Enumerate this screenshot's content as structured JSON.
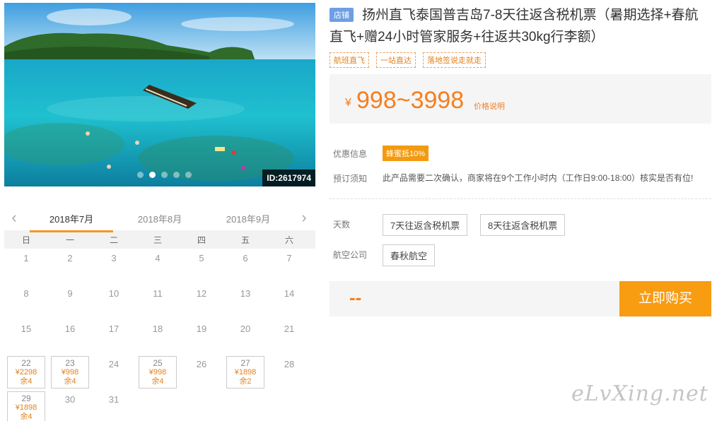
{
  "hero": {
    "id_label": "ID:2617974",
    "slide_count": 5,
    "active_slide": 1
  },
  "calendar": {
    "months": [
      "2018年7月",
      "2018年8月",
      "2018年9月"
    ],
    "active_month": 0,
    "weekdays": [
      "日",
      "一",
      "二",
      "三",
      "四",
      "五",
      "六"
    ],
    "first_weekday": 0,
    "days": [
      {
        "d": "1"
      },
      {
        "d": "2"
      },
      {
        "d": "3"
      },
      {
        "d": "4"
      },
      {
        "d": "5"
      },
      {
        "d": "6"
      },
      {
        "d": "7"
      },
      {
        "d": "8"
      },
      {
        "d": "9"
      },
      {
        "d": "10"
      },
      {
        "d": "11"
      },
      {
        "d": "12"
      },
      {
        "d": "13"
      },
      {
        "d": "14"
      },
      {
        "d": "15"
      },
      {
        "d": "16"
      },
      {
        "d": "17"
      },
      {
        "d": "18"
      },
      {
        "d": "19"
      },
      {
        "d": "20"
      },
      {
        "d": "21"
      },
      {
        "d": "22",
        "price": "¥2298",
        "stock": "余4"
      },
      {
        "d": "23",
        "price": "¥998",
        "stock": "余4"
      },
      {
        "d": "24"
      },
      {
        "d": "25",
        "price": "¥998",
        "stock": "余4"
      },
      {
        "d": "26"
      },
      {
        "d": "27",
        "price": "¥1898",
        "stock": "余2"
      },
      {
        "d": "28"
      },
      {
        "d": "29",
        "price": "¥1898",
        "stock": "余4"
      },
      {
        "d": "30"
      },
      {
        "d": "31"
      }
    ]
  },
  "product": {
    "shop_badge": "店铺",
    "title": "扬州直飞泰国普吉岛7-8天往返含税机票（暑期选择+春航直飞+赠24小时管家服务+往返共30kg行李额）",
    "tags": [
      "航班直飞",
      "一站直达",
      "落地签说走就走"
    ],
    "currency": "¥",
    "price_range": "998~3998",
    "price_note": "价格说明",
    "promo_label": "优惠信息",
    "promo_badge": "蜂蜜抵10%",
    "notice_label": "预订须知",
    "notice_text": "此产品需要二次确认，商家将在9个工作小时内（工作日9:00-18:00）核实是否有位!"
  },
  "options": {
    "days_label": "天数",
    "days": [
      "7天往返含税机票",
      "8天往返含税机票"
    ],
    "airline_label": "航空公司",
    "airlines": [
      "春秋航空"
    ]
  },
  "buy": {
    "total_placeholder": "--",
    "button": "立即购买"
  },
  "watermark": "eLvXing.net",
  "colors": {
    "accent": "#f89c12",
    "price": "#f47f20",
    "shop_badge": "#6d9fe5"
  }
}
